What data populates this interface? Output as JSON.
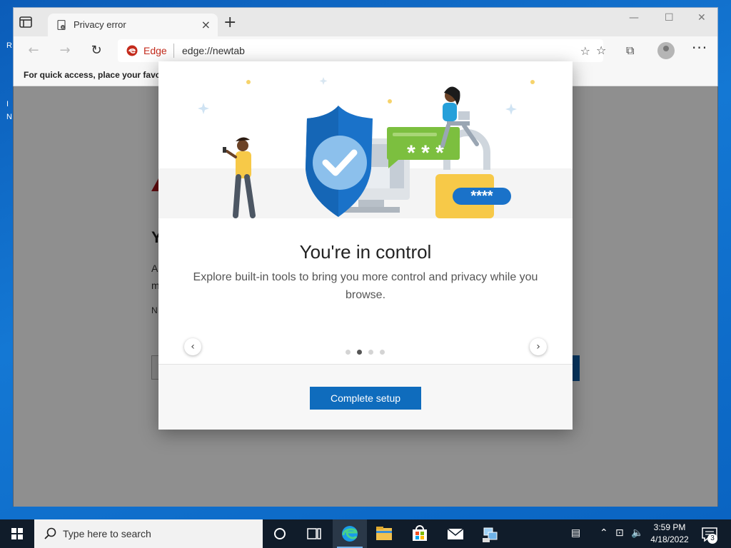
{
  "browser": {
    "tab_title": "Privacy error",
    "new_tab_glyph": "+",
    "address_brand": "Edge",
    "url": "edge://newtab",
    "favorites_bar_text": "For quick access, place your favorites here on the favorites bar.",
    "window_controls": {
      "minimize": "—",
      "maximize": "☐",
      "close": "✕"
    },
    "nav": {
      "back": "←",
      "forward": "→",
      "refresh": "↻"
    },
    "more_glyph": "···"
  },
  "background_page": {
    "title_peek": "Y",
    "line1_peek": "A",
    "line2_peek": "m",
    "line3_peek": "N"
  },
  "dialog": {
    "title": "You're in control",
    "description": "Explore built-in tools to bring you more control and privacy while you browse.",
    "prev_glyph": "‹",
    "next_glyph": "›",
    "page_count": 4,
    "active_page": 2,
    "cta_label": "Complete setup"
  },
  "taskbar": {
    "search_placeholder": "Type here to search",
    "time": "3:59 PM",
    "date": "4/18/2022",
    "notification_count": "3",
    "apps": [
      "cortana-icon",
      "task-view-icon",
      "edge-icon",
      "file-explorer-icon",
      "store-icon",
      "mail-icon",
      "network-app-icon"
    ]
  },
  "colors": {
    "accent": "#0f6cbd",
    "edge_red": "#c42b1c",
    "shield_blue": "#1a72c9",
    "message_green": "#7cbf3f",
    "lock_yellow": "#f7c948"
  }
}
